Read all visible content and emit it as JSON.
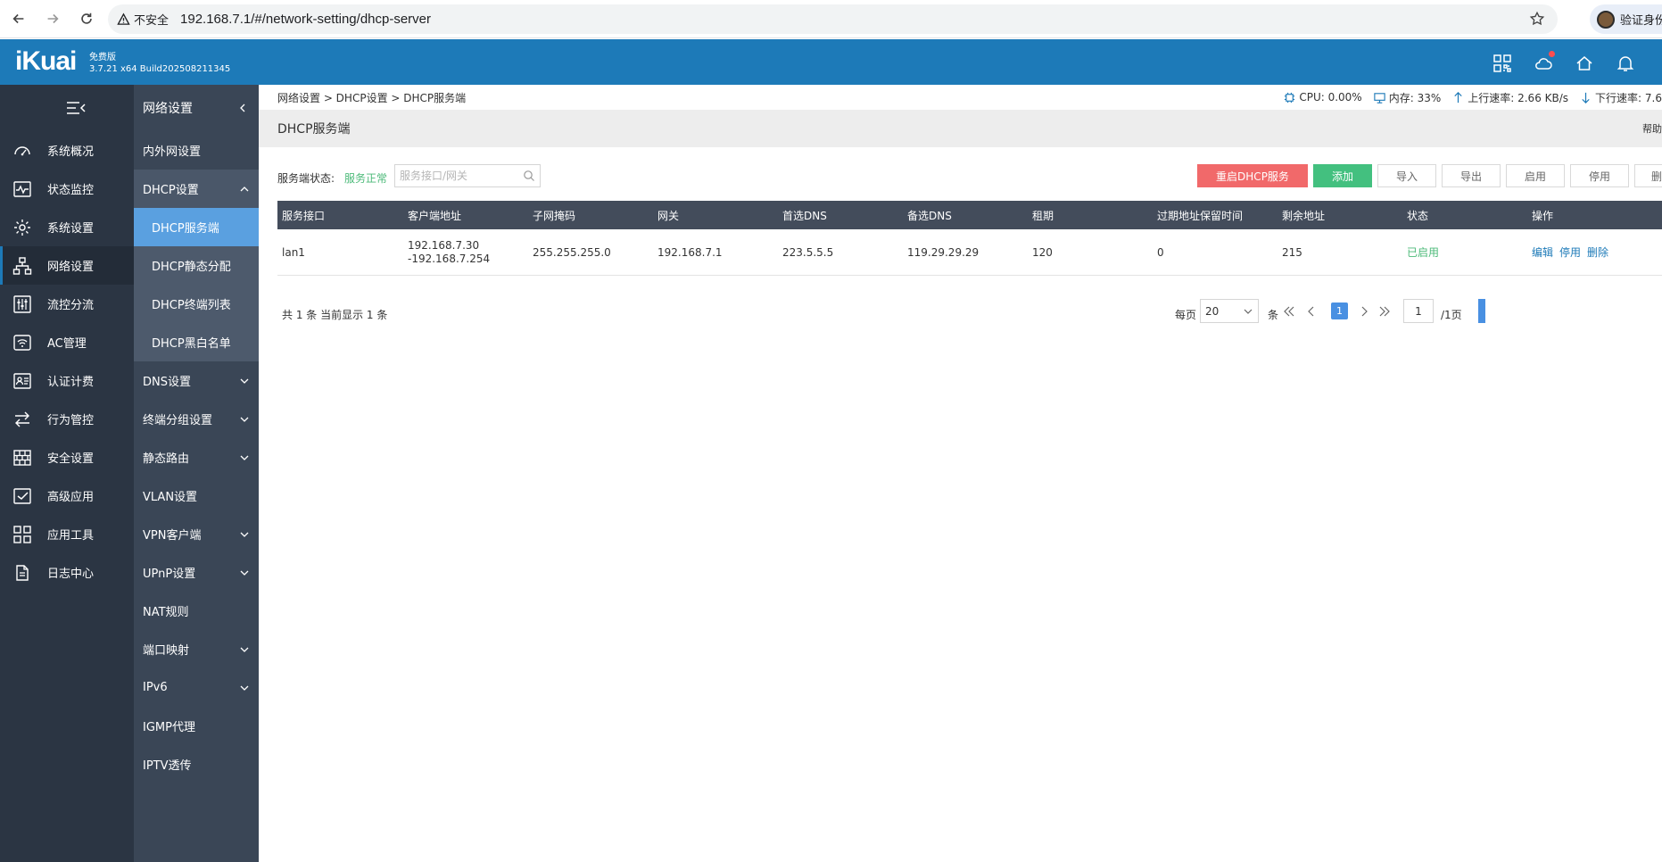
{
  "browser": {
    "security_label": "不安全",
    "url": "192.168.7.1/#/network-setting/dhcp-server",
    "profile_label": "验证身份"
  },
  "header": {
    "logo": "iKuai",
    "edition": "免费版",
    "build": "3.7.21 x64 Build202508211345"
  },
  "sidebar": {
    "items": [
      {
        "label": "系统概况",
        "icon": "dashboard-icon"
      },
      {
        "label": "状态监控",
        "icon": "monitor-icon"
      },
      {
        "label": "系统设置",
        "icon": "gear-icon"
      },
      {
        "label": "网络设置",
        "icon": "network-icon",
        "active": true
      },
      {
        "label": "流控分流",
        "icon": "sliders-icon"
      },
      {
        "label": "AC管理",
        "icon": "wifi-ap-icon"
      },
      {
        "label": "认证计费",
        "icon": "id-card-icon"
      },
      {
        "label": "行为管控",
        "icon": "swap-icon"
      },
      {
        "label": "安全设置",
        "icon": "firewall-icon"
      },
      {
        "label": "高级应用",
        "icon": "checkbox-icon"
      },
      {
        "label": "应用工具",
        "icon": "apps-icon"
      },
      {
        "label": "日志中心",
        "icon": "document-icon"
      }
    ]
  },
  "subsidebar": {
    "title": "网络设置",
    "items": [
      {
        "label": "内外网设置"
      },
      {
        "label": "DHCP设置"
      },
      {
        "label": "DHCP服务端"
      },
      {
        "label": "DHCP静态分配"
      },
      {
        "label": "DHCP终端列表"
      },
      {
        "label": "DHCP黑白名单"
      },
      {
        "label": "DNS设置"
      },
      {
        "label": "终端分组设置"
      },
      {
        "label": "静态路由"
      },
      {
        "label": "VLAN设置"
      },
      {
        "label": "VPN客户端"
      },
      {
        "label": "UPnP设置"
      },
      {
        "label": "NAT规则"
      },
      {
        "label": "端口映射"
      },
      {
        "label": "IPv6"
      },
      {
        "label": "IGMP代理"
      },
      {
        "label": "IPTV透传"
      }
    ]
  },
  "content": {
    "breadcrumb": "网络设置 > DHCP设置 > DHCP服务端",
    "stats": {
      "cpu": "CPU: 0.00%",
      "memory": "内存: 33%",
      "upload": "上行速率: 2.66 KB/s",
      "download": "下行速率: 7.6"
    },
    "title": "DHCP服务端",
    "help": "帮助",
    "service_label": "服务端状态:",
    "service_status": "服务正常",
    "search_placeholder": "服务接口/网关",
    "buttons": {
      "restart": "重启DHCP服务",
      "add": "添加",
      "import": "导入",
      "export": "导出",
      "enable": "启用",
      "disable": "停用",
      "delete": "删"
    },
    "table": {
      "headers": [
        "服务接口",
        "客户端地址",
        "子网掩码",
        "网关",
        "首选DNS",
        "备选DNS",
        "租期",
        "过期地址保留时间",
        "剩余地址",
        "状态",
        "操作"
      ],
      "rows": [
        {
          "interface": "lan1",
          "range_start": "192.168.7.30",
          "range_end": "-192.168.7.254",
          "netmask": "255.255.255.0",
          "gateway": "192.168.7.1",
          "dns1": "223.5.5.5",
          "dns2": "119.29.29.29",
          "lease": "120",
          "expire_keep": "0",
          "remaining": "215",
          "status": "已启用",
          "actions": [
            "编辑",
            "停用",
            "删除"
          ]
        }
      ]
    },
    "pager": {
      "total_text": "共 1 条 当前显示 1 条",
      "per_page_label": "每页",
      "per_page_value": "20",
      "unit": "条",
      "current_page": "1",
      "page_input": "1",
      "page_total": "/1页"
    }
  },
  "colors": {
    "header_blue": "#1d7ab8",
    "sidebar": "#2b3543",
    "subsidebar": "#3a4656",
    "active_blue": "#5aa0e0",
    "restart_red": "#f1696a",
    "add_green": "#43c07f",
    "status_green": "#4cba79"
  }
}
